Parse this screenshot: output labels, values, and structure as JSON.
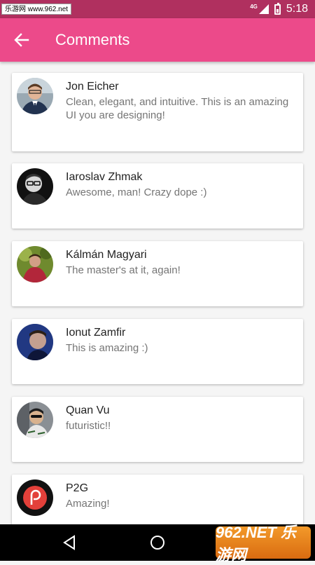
{
  "status_bar": {
    "watermark_site": "乐游网 www.962.net",
    "network": "4G",
    "time": "5:18"
  },
  "app_bar": {
    "title": "Comments",
    "back_icon": "arrow-left-icon"
  },
  "comments": [
    {
      "name": "Jon Eicher",
      "text": "Clean, elegant, and intuitive. This is an amazing UI you are designing!"
    },
    {
      "name": "Iaroslav Zhmak",
      "text": "Awesome, man! Crazy dope :)"
    },
    {
      "name": "Kálmán Magyari",
      "text": "The master's at it, again!"
    },
    {
      "name": "Ionut Zamfir",
      "text": "This is amazing :)"
    },
    {
      "name": "Quan Vu",
      "text": "futuristic!!"
    },
    {
      "name": "P2G",
      "text": "Amazing!"
    }
  ],
  "nav_bar": {
    "back_icon": "triangle-back-icon",
    "home_icon": "circle-home-icon",
    "watermark": "962.NET 乐游网"
  },
  "colors": {
    "status_bar": "#b0305f",
    "app_bar": "#ec4a8a",
    "background": "#f5f5f5"
  }
}
